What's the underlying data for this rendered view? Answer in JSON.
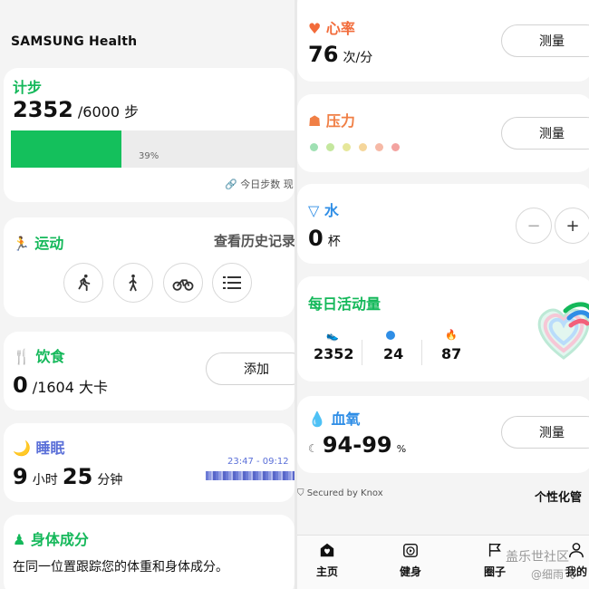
{
  "left": {
    "brand": "SAMSUNG Health",
    "steps": {
      "title": "计步",
      "current": "2352",
      "goal": "/6000 步",
      "progress_fraction": 0.39,
      "progress_label": "39%",
      "today_link": "今日步数 现"
    },
    "exercise": {
      "title": "运动",
      "history_link": "查看历史记录",
      "icons": [
        "running-icon",
        "walking-icon",
        "cycling-icon",
        "list-icon"
      ]
    },
    "food": {
      "title": "饮食",
      "value": "0",
      "target": "/1604 大卡",
      "add_label": "添加"
    },
    "sleep": {
      "title": "睡眠",
      "hours": "9",
      "hours_unit": "小时",
      "minutes": "25",
      "minutes_unit": "分钟",
      "range": "23:47 - 09:12"
    },
    "body": {
      "title": "身体成分",
      "desc": "在同一位置跟踪您的体重和身体成分。"
    }
  },
  "right": {
    "heart": {
      "title": "心率",
      "value": "76",
      "unit": "次/分",
      "button": "测量"
    },
    "stress": {
      "title": "压力",
      "button": "测量",
      "dot_colors": [
        "#9fe0b3",
        "#c4e79e",
        "#e6e79a",
        "#f5d69b",
        "#f6b9a6",
        "#f3a3a0"
      ]
    },
    "water": {
      "title": "水",
      "value": "0",
      "unit": "杯",
      "minus": "−",
      "plus": "+"
    },
    "activity": {
      "title": "每日活动量",
      "steps": "2352",
      "minutes": "24",
      "calories": "87"
    },
    "spo2": {
      "title": "血氧",
      "value": "94-99",
      "unit": "%",
      "button": "测量"
    },
    "knox": "Secured by Knox",
    "personalize": "个性化管",
    "nav": [
      {
        "label": "主页",
        "icon": "home-icon"
      },
      {
        "label": "健身",
        "icon": "play-icon"
      },
      {
        "label": "圈子",
        "icon": "flag-icon"
      },
      {
        "label": "我的",
        "icon": "person-icon"
      }
    ],
    "watermark": "盖乐世社区",
    "watermark_sub": "@细雨飞"
  },
  "colors": {
    "accent_green": "#14b85a",
    "heart": "#f26b3a",
    "stress": "#f07f45",
    "water": "#2f8ee6",
    "sleep": "#5a6fd8",
    "spo2": "#2f8ee6"
  }
}
